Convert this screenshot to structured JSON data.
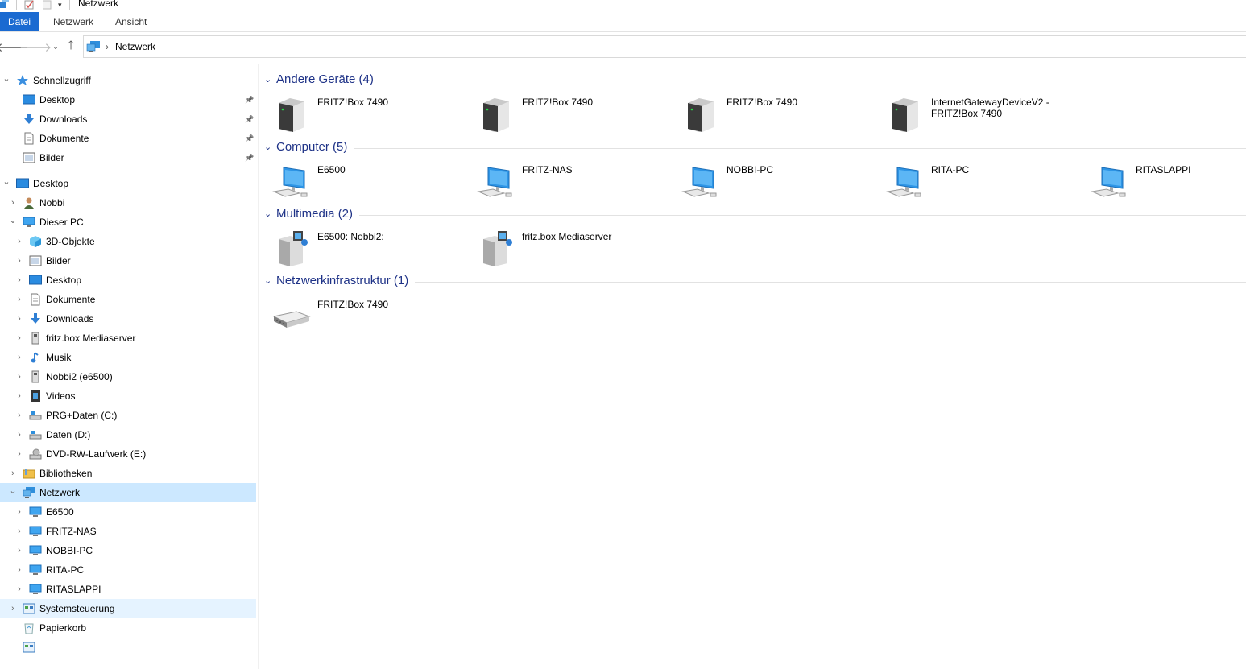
{
  "window": {
    "title": "Netzwerk"
  },
  "ribbon": {
    "tabs": [
      "Datei",
      "Netzwerk",
      "Ansicht"
    ]
  },
  "address": {
    "path": [
      "Netzwerk"
    ]
  },
  "nav": {
    "items": [
      {
        "label": "Schnellzugriff",
        "icon": "star-icon",
        "pinned": false,
        "expanded": true
      },
      {
        "label": "Desktop",
        "icon": "desktop-icon",
        "pinned": true
      },
      {
        "label": "Downloads",
        "icon": "download-icon",
        "pinned": true
      },
      {
        "label": "Dokumente",
        "icon": "document-icon",
        "pinned": true
      },
      {
        "label": "Bilder",
        "icon": "pictures-icon",
        "pinned": true
      },
      {
        "label": "Desktop",
        "icon": "desktop-icon",
        "expanded": true
      },
      {
        "label": "Nobbi",
        "icon": "user-icon"
      },
      {
        "label": "Dieser PC",
        "icon": "computer-icon",
        "expanded": true
      },
      {
        "label": "3D-Objekte",
        "icon": "cube-icon"
      },
      {
        "label": "Bilder",
        "icon": "pictures-icon"
      },
      {
        "label": "Desktop",
        "icon": "desktop-icon"
      },
      {
        "label": "Dokumente",
        "icon": "document-icon"
      },
      {
        "label": "Downloads",
        "icon": "download-icon"
      },
      {
        "label": "fritz.box Mediaserver",
        "icon": "media-server-icon"
      },
      {
        "label": "Musik",
        "icon": "music-icon"
      },
      {
        "label": "Nobbi2 (e6500)",
        "icon": "media-server-icon"
      },
      {
        "label": "Videos",
        "icon": "video-icon"
      },
      {
        "label": "PRG+Daten (C:)",
        "icon": "drive-icon"
      },
      {
        "label": "Daten (D:)",
        "icon": "drive-icon"
      },
      {
        "label": "DVD-RW-Laufwerk (E:)",
        "icon": "dvd-drive-icon"
      },
      {
        "label": "Bibliotheken",
        "icon": "library-icon"
      },
      {
        "label": "Netzwerk",
        "icon": "network-icon",
        "expanded": true,
        "selected": true
      },
      {
        "label": "E6500",
        "icon": "computer-icon"
      },
      {
        "label": "FRITZ-NAS",
        "icon": "computer-icon"
      },
      {
        "label": "NOBBI-PC",
        "icon": "computer-icon"
      },
      {
        "label": "RITA-PC",
        "icon": "computer-icon"
      },
      {
        "label": "RITASLAPPI",
        "icon": "computer-icon"
      },
      {
        "label": "Systemsteuerung",
        "icon": "control-panel-icon",
        "hover": true
      },
      {
        "label": "Papierkorb",
        "icon": "recycle-bin-icon"
      },
      {
        "label": "",
        "icon": "control-panel-icon"
      }
    ]
  },
  "groups": [
    {
      "title": "Andere Geräte (4)",
      "items": [
        {
          "label": "FRITZ!Box 7490",
          "icon": "device-tower-icon"
        },
        {
          "label": "FRITZ!Box 7490",
          "icon": "device-tower-icon"
        },
        {
          "label": "FRITZ!Box 7490",
          "icon": "device-tower-icon"
        },
        {
          "label": "InternetGatewayDeviceV2 - FRITZ!Box 7490",
          "icon": "device-tower-icon"
        }
      ]
    },
    {
      "title": "Computer (5)",
      "items": [
        {
          "label": "E6500",
          "icon": "network-computer-icon"
        },
        {
          "label": "FRITZ-NAS",
          "icon": "network-computer-icon"
        },
        {
          "label": "NOBBI-PC",
          "icon": "network-computer-icon"
        },
        {
          "label": "RITA-PC",
          "icon": "network-computer-icon"
        },
        {
          "label": "RITASLAPPI",
          "icon": "network-computer-icon"
        }
      ]
    },
    {
      "title": "Multimedia (2)",
      "items": [
        {
          "label": "E6500: Nobbi2:",
          "icon": "media-device-icon"
        },
        {
          "label": "fritz.box Mediaserver",
          "icon": "media-device-icon"
        }
      ]
    },
    {
      "title": "Netzwerkinfrastruktur (1)",
      "items": [
        {
          "label": "FRITZ!Box 7490",
          "icon": "router-icon"
        }
      ]
    }
  ],
  "colors": {
    "accent": "#1a6ad1",
    "group_title": "#1e3287",
    "selection": "#cce8ff",
    "hover": "#e5f3ff"
  }
}
